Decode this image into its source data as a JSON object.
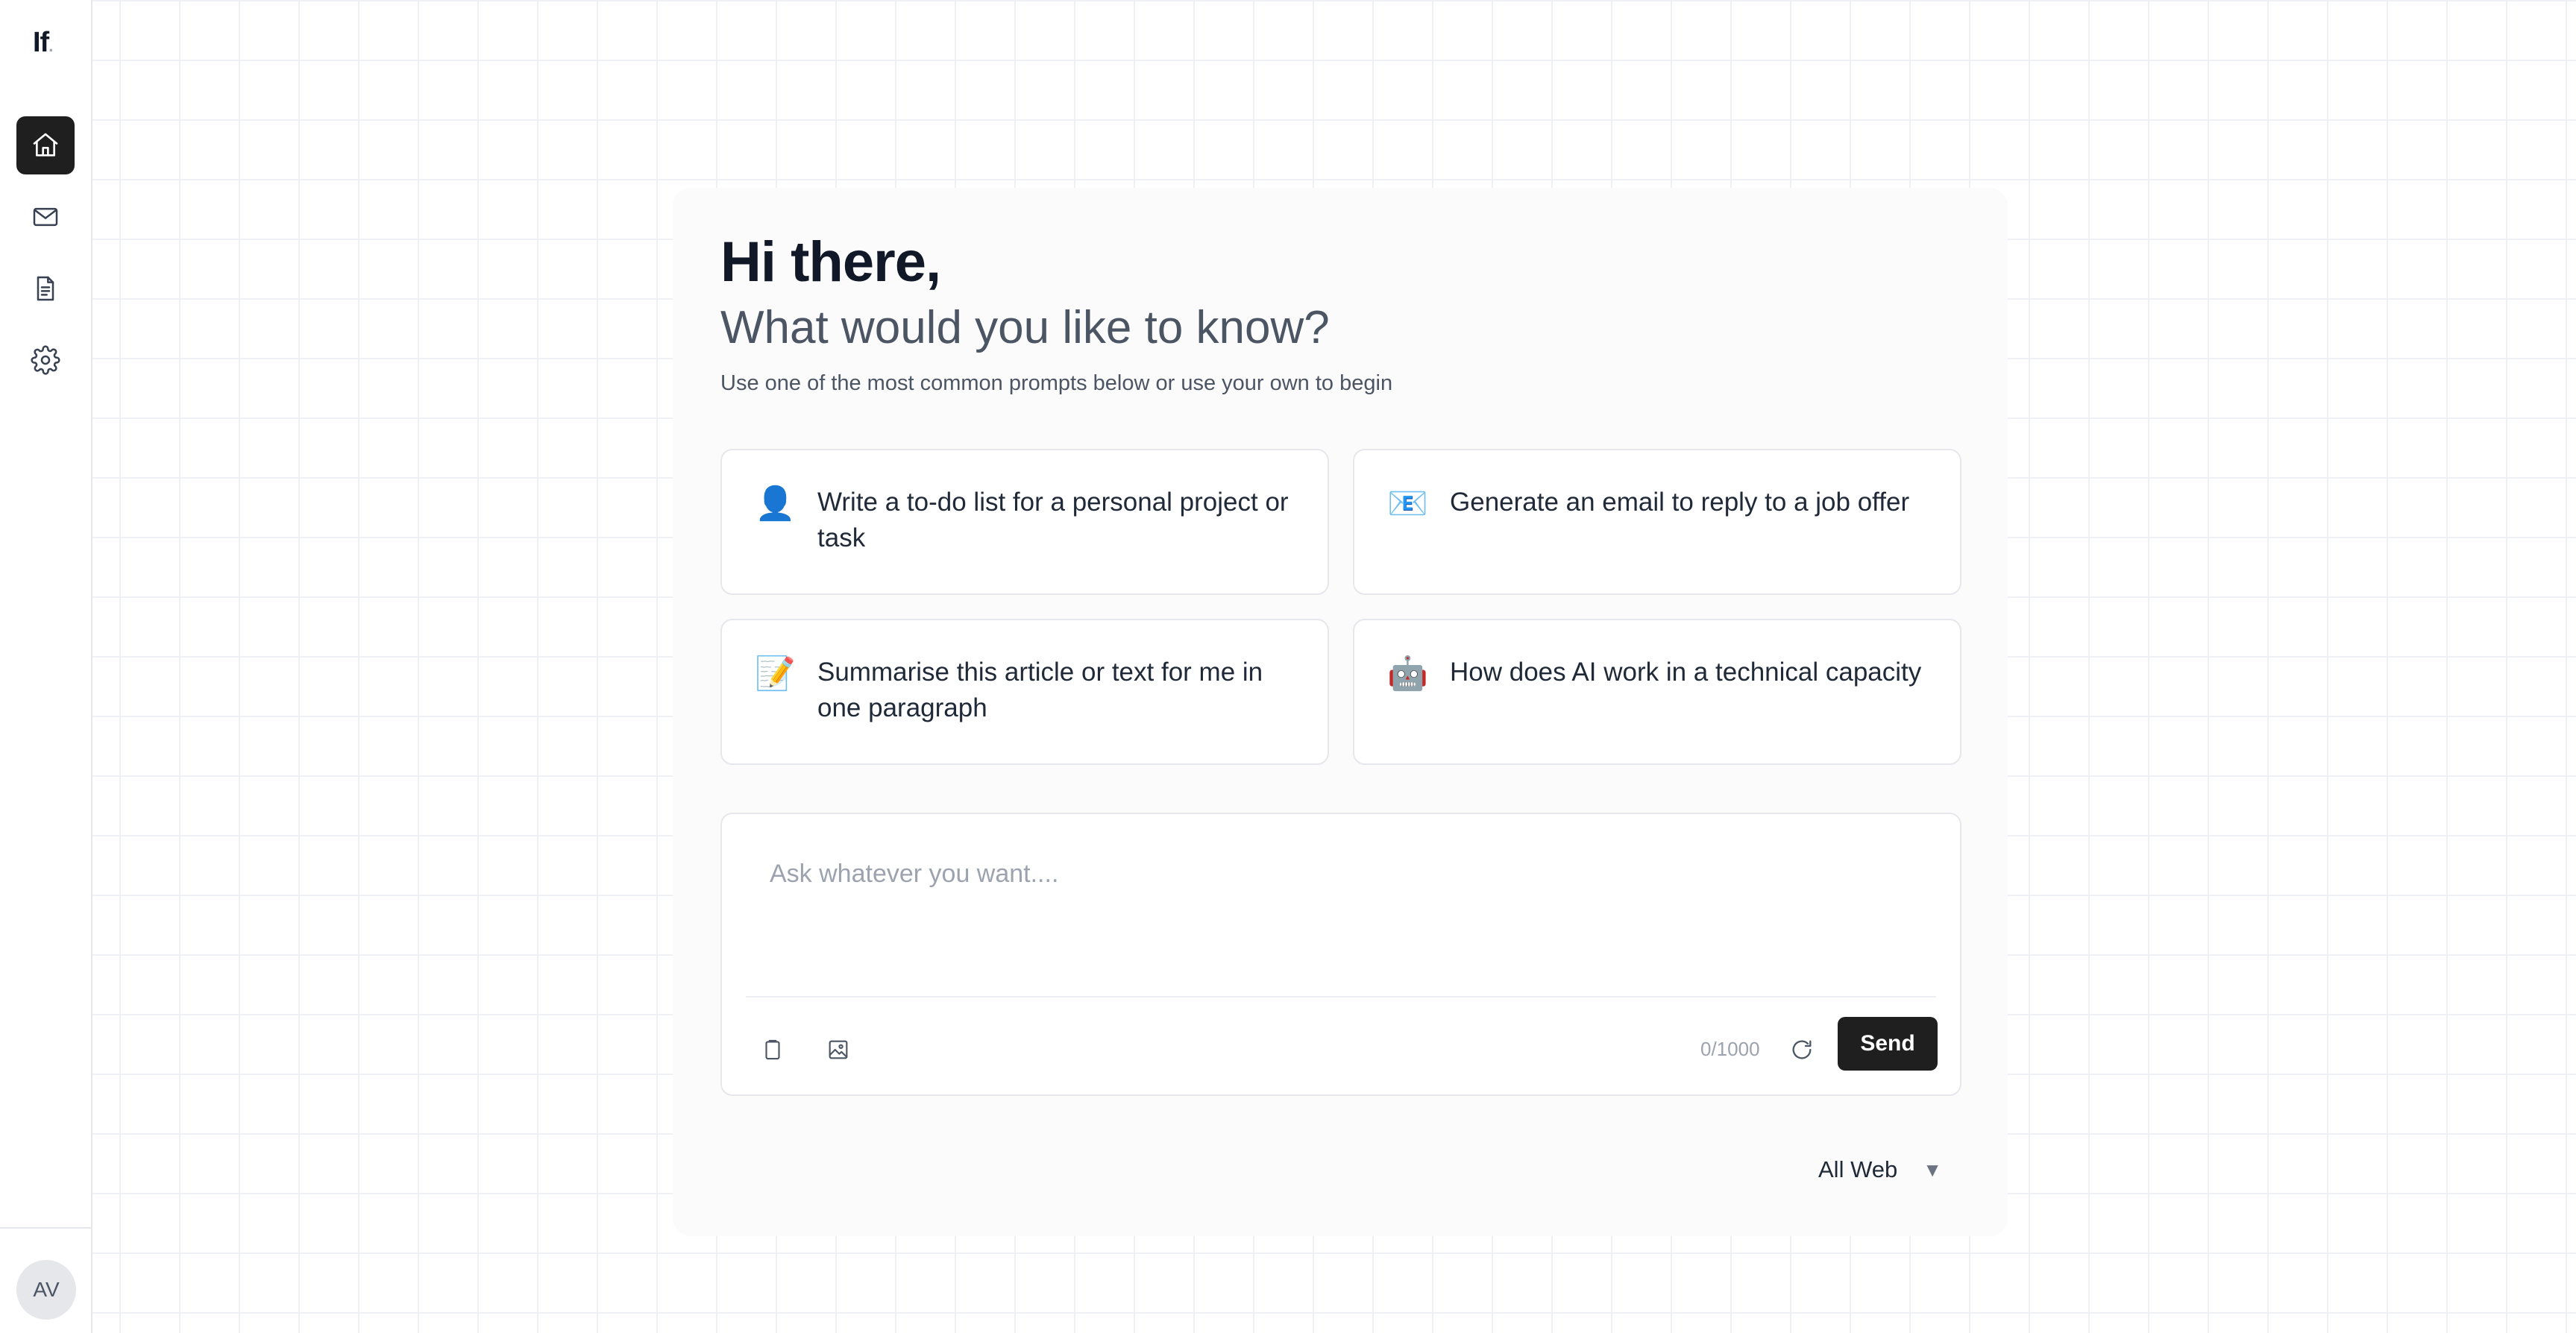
{
  "sidebar": {
    "logo": "If",
    "logo_dot": ".",
    "nav": [
      {
        "name": "home-icon",
        "active": true
      },
      {
        "name": "mail-icon",
        "active": false
      },
      {
        "name": "document-icon",
        "active": false
      },
      {
        "name": "settings-icon",
        "active": false
      }
    ],
    "avatar_initials": "AV"
  },
  "main": {
    "greeting": "Hi there,",
    "question": "What would you like to know?",
    "hint": "Use one of the most common prompts below or use your own to begin",
    "prompts": [
      {
        "emoji": "👤",
        "icon": "person-icon",
        "text": "Write a to-do list for a personal project or task"
      },
      {
        "emoji": "📧",
        "icon": "email-icon",
        "text": "Generate an email to reply to a job offer"
      },
      {
        "emoji": "📝",
        "icon": "memo-icon",
        "text": "Summarise this article or text for me in one paragraph"
      },
      {
        "emoji": "🤖",
        "icon": "robot-icon",
        "text": "How does AI work in a technical capacity"
      }
    ],
    "input": {
      "placeholder": "Ask whatever you want....",
      "value": "",
      "char_count": "0/1000",
      "send_label": "Send"
    },
    "scope": {
      "selected": "All Web",
      "caret": "▼"
    }
  },
  "colors": {
    "accent_dark": "#1f1f1f",
    "grid_line": "#eef0f3",
    "muted_text": "#9ca3af"
  }
}
